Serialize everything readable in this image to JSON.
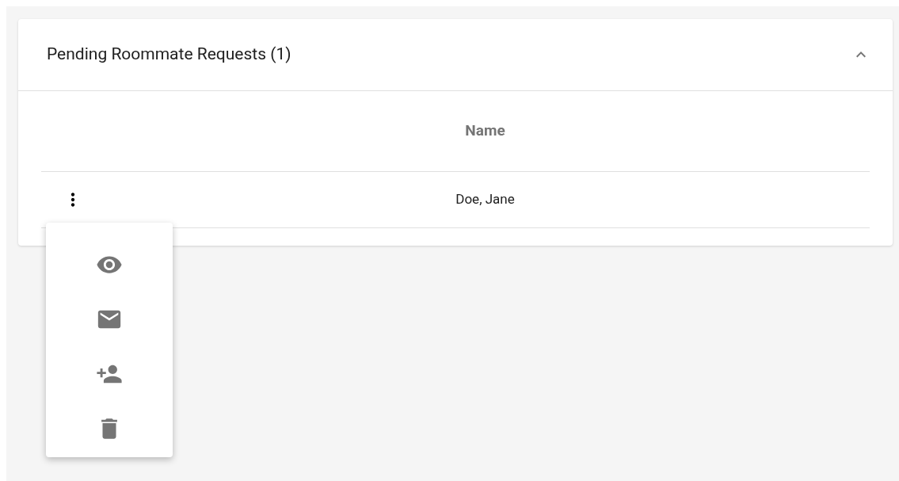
{
  "panel": {
    "title": "Pending Roommate Requests (1)",
    "expanded": true
  },
  "table": {
    "columns": [
      {
        "kind": "actions"
      },
      {
        "kind": "text",
        "label": "Name"
      }
    ],
    "rows": [
      {
        "name": "Doe, Jane"
      }
    ]
  },
  "menu": {
    "open": true,
    "items": [
      {
        "kind": "view"
      },
      {
        "kind": "email"
      },
      {
        "kind": "add-person"
      },
      {
        "kind": "delete"
      }
    ]
  }
}
